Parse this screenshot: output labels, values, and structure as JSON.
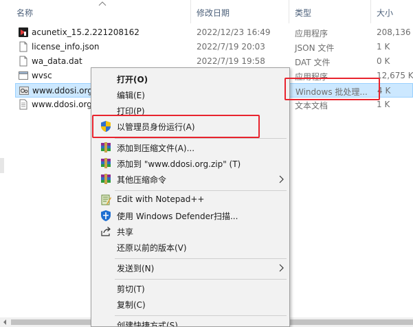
{
  "columns": {
    "name": "名称",
    "date": "修改日期",
    "type": "类型",
    "size": "大小"
  },
  "files": [
    {
      "name": "acunetix_15.2.221208162",
      "date": "2022/12/23 16:49",
      "type": "应用程序",
      "size": "208,136 K",
      "icon": "acunetix-app-icon"
    },
    {
      "name": "license_info.json",
      "date": "2022/7/19 20:03",
      "type": "JSON 文件",
      "size": "1 K",
      "icon": "json-file-icon"
    },
    {
      "name": "wa_data.dat",
      "date": "2022/7/19 19:58",
      "type": "DAT 文件",
      "size": "0 K",
      "icon": "dat-file-icon"
    },
    {
      "name": "wvsc",
      "date": "",
      "type": "应用程序",
      "size": "12,675 K",
      "icon": "app-icon"
    },
    {
      "name": "www.ddosi.org",
      "date": "",
      "type": "Windows 批处理...",
      "size": "4 K",
      "icon": "batch-file-icon",
      "selected": true
    },
    {
      "name": "www.ddosi.org",
      "date": "",
      "type": "文本文档",
      "size": "1 K",
      "icon": "text-file-icon"
    }
  ],
  "context_menu": {
    "open": "打开(O)",
    "edit": "编辑(E)",
    "print": "打印(P)",
    "run_as_admin": "以管理员身份运行(A)",
    "add_to_archive": "添加到压缩文件(A)...",
    "add_to_zip": "添加到 \"www.ddosi.org.zip\" (T)",
    "other_compress": "其他压缩命令",
    "edit_notepadpp": "Edit with Notepad++",
    "defender_scan": "使用 Windows Defender扫描...",
    "share": "共享",
    "restore_versions": "还原以前的版本(V)",
    "send_to": "发送到(N)",
    "cut": "剪切(T)",
    "copy": "复制(C)",
    "create_shortcut": "创建快捷方式(S)"
  },
  "colors": {
    "selection": "#cce8ff",
    "highlight_frame": "#e8232d",
    "menu_bg": "#f2f2f2"
  }
}
